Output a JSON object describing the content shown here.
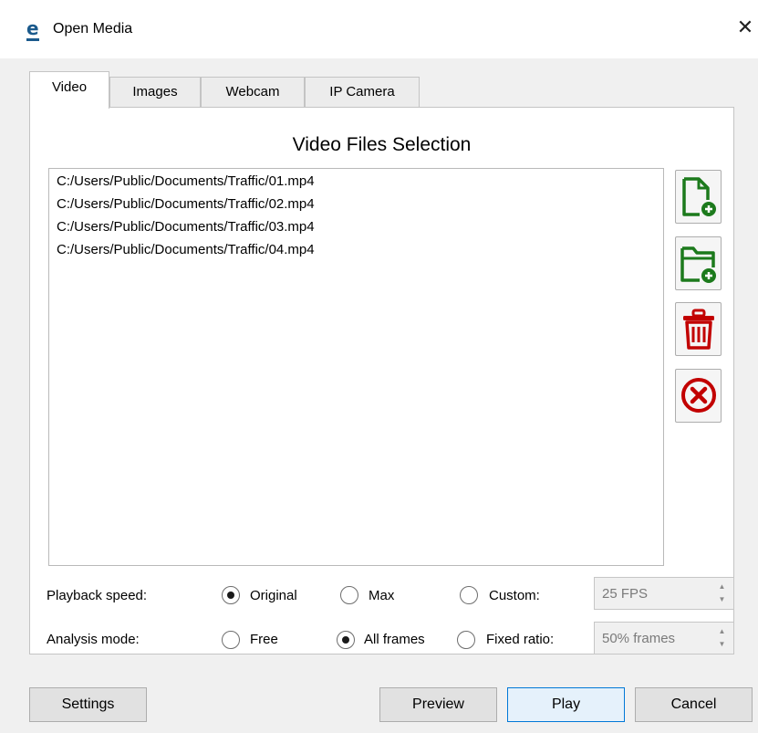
{
  "window": {
    "title": "Open Media",
    "close_label": "✕",
    "app_icon": "e"
  },
  "tabs": [
    {
      "label": "Video",
      "active": true
    },
    {
      "label": "Images",
      "active": false
    },
    {
      "label": "Webcam",
      "active": false
    },
    {
      "label": "IP Camera",
      "active": false
    }
  ],
  "video": {
    "heading": "Video Files Selection",
    "files": [
      "C:/Users/Public/Documents/Traffic/01.mp4",
      "C:/Users/Public/Documents/Traffic/02.mp4",
      "C:/Users/Public/Documents/Traffic/03.mp4",
      "C:/Users/Public/Documents/Traffic/04.mp4"
    ],
    "actions": [
      {
        "icon": "add-file-icon",
        "color": "#1c7a1c"
      },
      {
        "icon": "add-folder-icon",
        "color": "#1c7a1c"
      },
      {
        "icon": "trash-icon",
        "color": "#c20000"
      },
      {
        "icon": "remove-all-icon",
        "color": "#c20000"
      }
    ]
  },
  "playback": {
    "label": "Playback speed:",
    "options": [
      {
        "label": "Original",
        "checked": true
      },
      {
        "label": "Max",
        "checked": false
      },
      {
        "label": "Custom:",
        "checked": false
      }
    ],
    "custom_value": "25 FPS"
  },
  "analysis": {
    "label": "Analysis mode:",
    "options": [
      {
        "label": "Free",
        "checked": false
      },
      {
        "label": "All frames",
        "checked": true
      },
      {
        "label": "Fixed ratio:",
        "checked": false
      }
    ],
    "ratio_value": "50% frames"
  },
  "buttons": {
    "settings": "Settings",
    "preview": "Preview",
    "play": "Play",
    "cancel": "Cancel"
  }
}
